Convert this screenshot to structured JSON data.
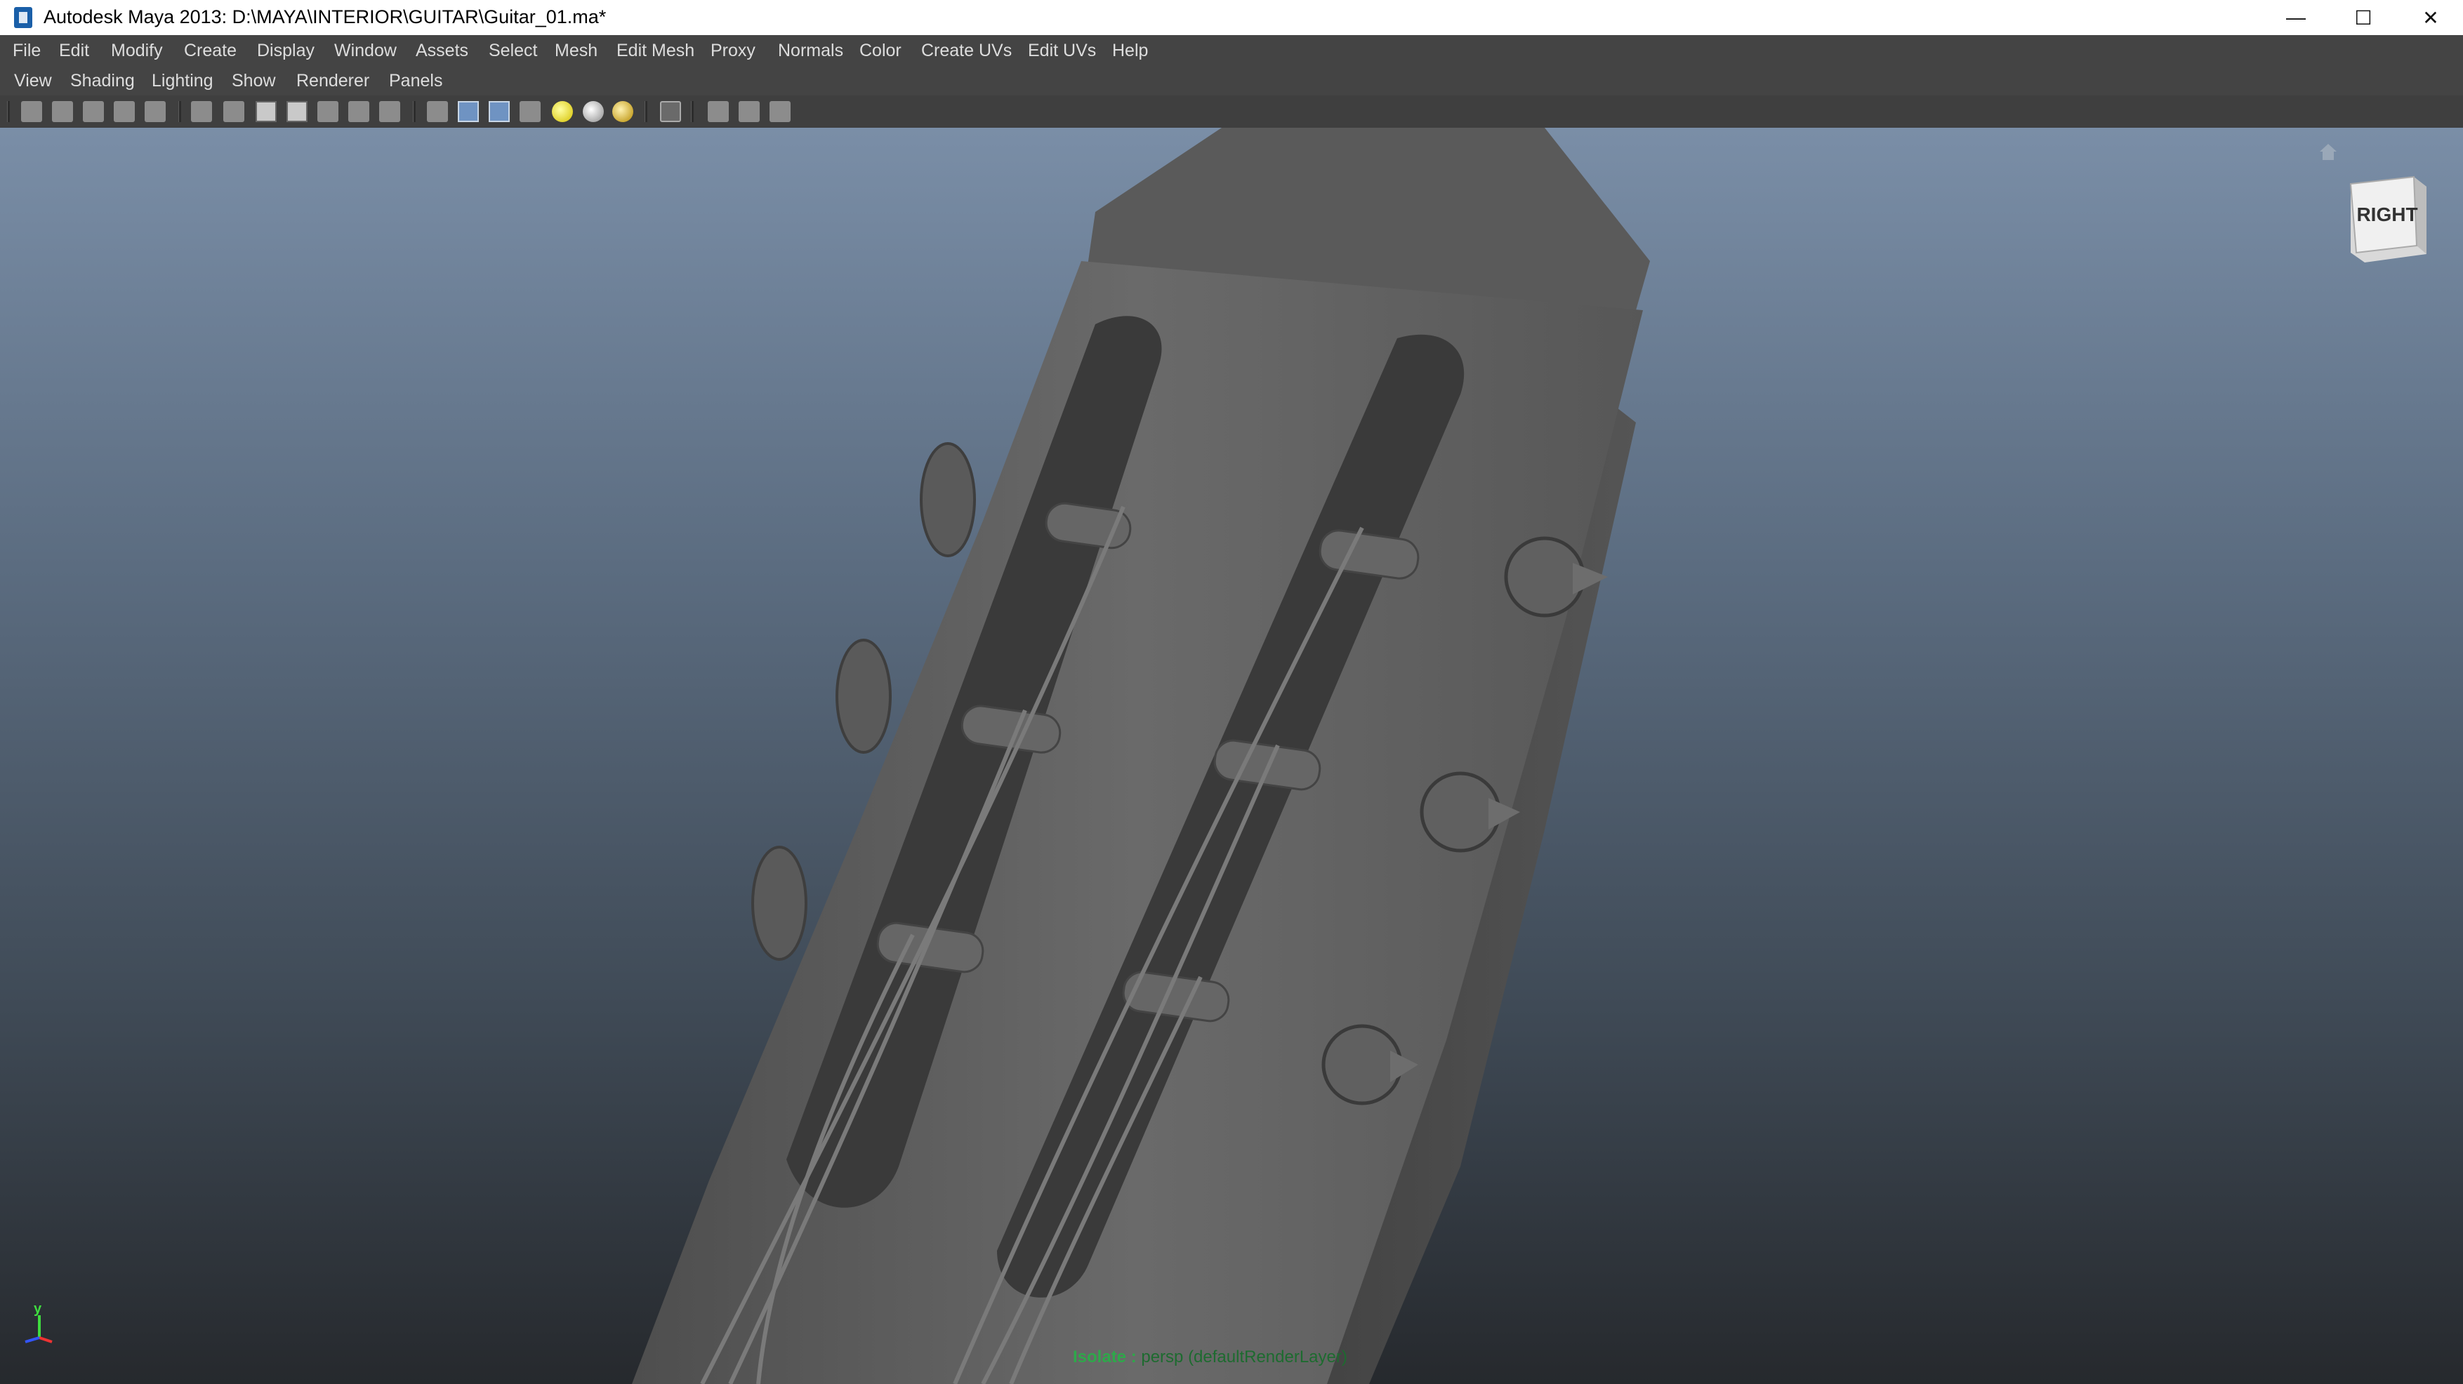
{
  "window": {
    "title": "Autodesk Maya 2013: D:\\MAYA\\INTERIOR\\GUITAR\\Guitar_01.ma*",
    "minimize_glyph": "—",
    "maximize_glyph": "☐",
    "close_glyph": "✕"
  },
  "menubar": {
    "items": [
      "File",
      "Edit",
      "Modify",
      "Create",
      "Display",
      "Window",
      "Assets",
      "Select",
      "Mesh",
      "Edit Mesh",
      "Proxy",
      "Normals",
      "Color",
      "Create UVs",
      "Edit UVs",
      "Help"
    ]
  },
  "panel_menu": {
    "items": [
      "View",
      "Shading",
      "Lighting",
      "Show",
      "Renderer",
      "Panels"
    ]
  },
  "toolbar": {
    "icons": [
      "select-camera-icon",
      "camera-attributes-icon",
      "bookmark-icon",
      "image-plane-icon",
      "2d-pan-zoom-icon",
      "grease-pencil-icon",
      "grid-icon",
      "film-gate-icon",
      "resolution-gate-icon",
      "gate-mask-icon",
      "field-chart-icon",
      "safe-action-icon",
      "safe-title-icon",
      "wireframe-icon",
      "smooth-shade-icon",
      "wireframe-on-shaded-icon",
      "textured-icon",
      "use-all-lights-icon",
      "shadows-icon",
      "default-material-icon",
      "isolate-select-icon",
      "xray-icon",
      "xray-joints-icon",
      "xray-active-components-icon"
    ]
  },
  "viewport": {
    "viewcube_label": "RIGHT",
    "axis": {
      "y_label": "y"
    },
    "status_prefix": "Isolate : ",
    "status_rest": "persp (defaultRenderLayer)"
  },
  "colors": {
    "menubar_bg": "#444444",
    "viewport_top": "#7a8ea7",
    "viewport_bottom": "#26292d",
    "model_gray": "#5d5d5d",
    "status_green": "#2ea84a"
  }
}
